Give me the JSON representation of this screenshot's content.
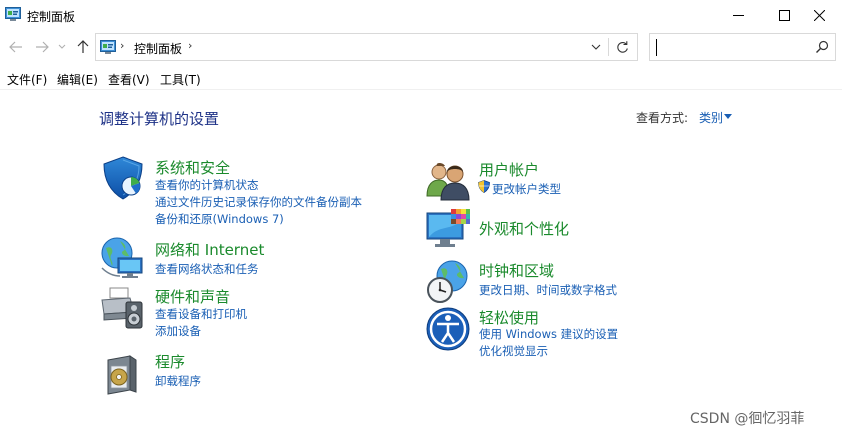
{
  "window": {
    "title": "控制面板",
    "icon": "control-panel-icon"
  },
  "address": {
    "crumb": "控制面板",
    "separator": "›"
  },
  "search": {
    "value": "",
    "placeholder": ""
  },
  "menu": [
    "文件(F)",
    "编辑(E)",
    "查看(V)",
    "工具(T)"
  ],
  "content": {
    "heading": "调整计算机的设置",
    "viewby_label": "查看方式:",
    "viewby_value": "类别"
  },
  "categories": {
    "system": {
      "title": "系统和安全",
      "icon": "shield-icon",
      "links": [
        "查看你的计算机状态",
        "通过文件历史记录保存你的文件备份副本",
        "备份和还原(Windows 7)"
      ]
    },
    "network": {
      "title": "网络和 Internet",
      "icon": "globe-network-icon",
      "links": [
        "查看网络状态和任务"
      ]
    },
    "hardware": {
      "title": "硬件和声音",
      "icon": "printer-speaker-icon",
      "links": [
        "查看设备和打印机",
        "添加设备"
      ]
    },
    "programs": {
      "title": "程序",
      "icon": "programs-disc-icon",
      "links": [
        "卸载程序"
      ]
    },
    "users": {
      "title": "用户帐户",
      "icon": "users-icon",
      "links": [
        "更改帐户类型"
      ]
    },
    "appearance": {
      "title": "外观和个性化",
      "icon": "monitor-palette-icon",
      "links": []
    },
    "clock": {
      "title": "时钟和区域",
      "icon": "clock-globe-icon",
      "links": [
        "更改日期、时间或数字格式"
      ]
    },
    "ease": {
      "title": "轻松使用",
      "icon": "ease-of-access-icon",
      "links": [
        "使用 Windows 建议的设置",
        "优化视觉显示"
      ]
    }
  },
  "watermark": "CSDN @徊忆羽菲",
  "colors": {
    "heading": "#1e3287",
    "category_title": "#1a8a2c",
    "link": "#1a5fb4"
  }
}
